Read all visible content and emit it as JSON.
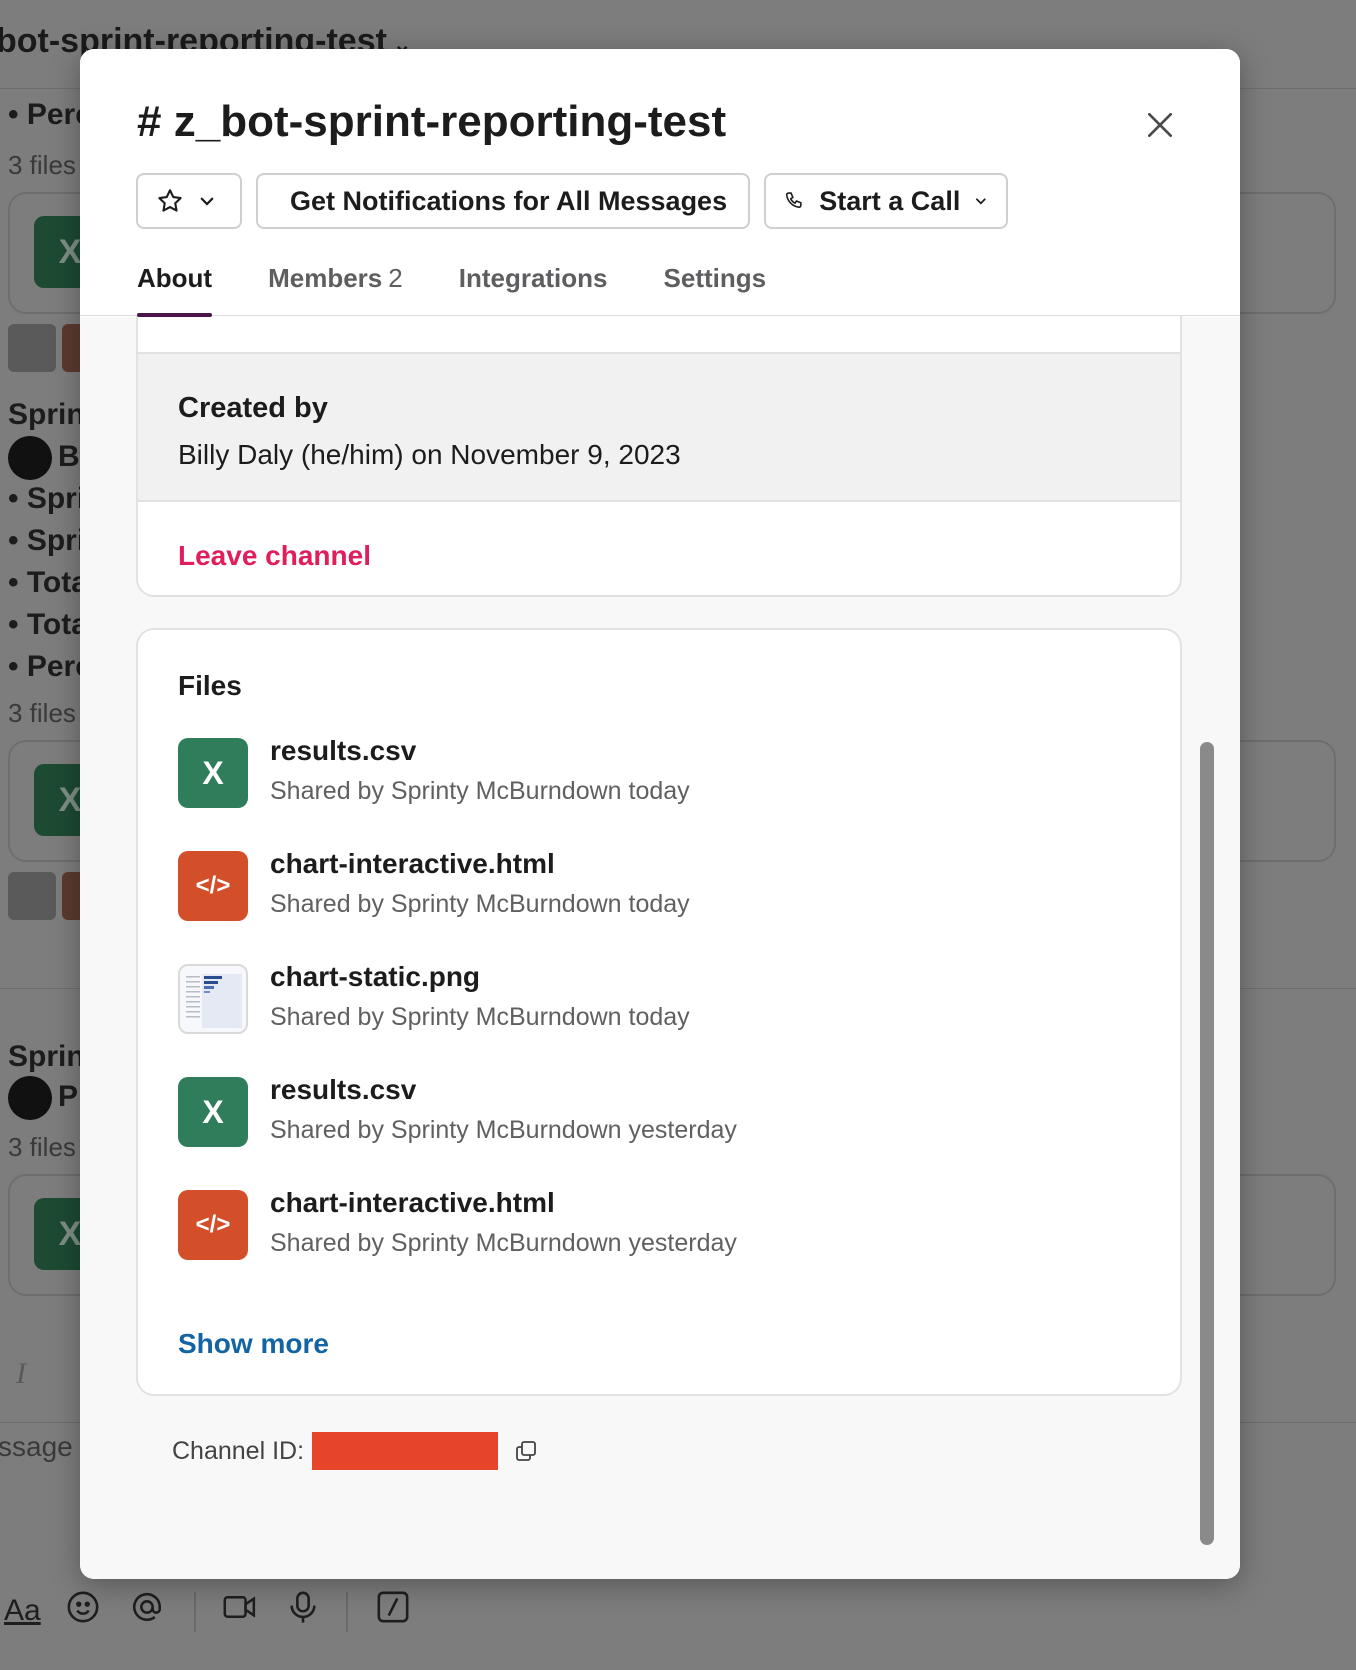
{
  "background": {
    "channel_header": "bot-sprint-reporting-test",
    "bullets": [
      "• Perc",
      "• Spri",
      "• Spri",
      "• Tota",
      "• Tota",
      "• Perc"
    ],
    "files_counts": [
      "3 files",
      "3 files",
      "3 files"
    ],
    "section_labels": [
      "Sprint",
      "Sprint"
    ],
    "user_initials": [
      "B",
      "P"
    ],
    "composer_placeholder": "ssage #",
    "composer_cursor": "I",
    "format_button": "Aa",
    "file_letter": "X"
  },
  "modal": {
    "title_hash": "#",
    "title": "z_bot-sprint-reporting-test",
    "notifications_label": "Get Notifications for All Messages",
    "call_label": "Start a Call",
    "tabs": {
      "about": "About",
      "members": "Members",
      "members_count": "2",
      "integrations": "Integrations",
      "settings": "Settings"
    },
    "created_by_label": "Created by",
    "created_by_value": "Billy Daly (he/him) on November 9, 2023",
    "leave_channel": "Leave channel",
    "files_title": "Files",
    "files": [
      {
        "name": "results.csv",
        "meta": "Shared by Sprinty McBurndown today",
        "type": "csv",
        "icon_text": "X"
      },
      {
        "name": "chart-interactive.html",
        "meta": "Shared by Sprinty McBurndown today",
        "type": "html",
        "icon_text": "</>"
      },
      {
        "name": "chart-static.png",
        "meta": "Shared by Sprinty McBurndown today",
        "type": "png"
      },
      {
        "name": "results.csv",
        "meta": "Shared by Sprinty McBurndown yesterday",
        "type": "csv",
        "icon_text": "X"
      },
      {
        "name": "chart-interactive.html",
        "meta": "Shared by Sprinty McBurndown yesterday",
        "type": "html",
        "icon_text": "</>"
      }
    ],
    "show_more": "Show more",
    "channel_id_label": "Channel ID:"
  },
  "colors": {
    "tab_underline": "#4a154b",
    "leave": "#e01e5a",
    "link": "#1264a3",
    "csv": "#2f7d5b",
    "html": "#d24f2a",
    "redaction": "#e6452a"
  },
  "icons": [
    "star-icon",
    "bell-icon",
    "phone-icon",
    "chevron-down-icon",
    "close-icon",
    "copy-icon",
    "emoji-icon",
    "mention-icon",
    "video-icon",
    "mic-icon",
    "slash-icon"
  ]
}
